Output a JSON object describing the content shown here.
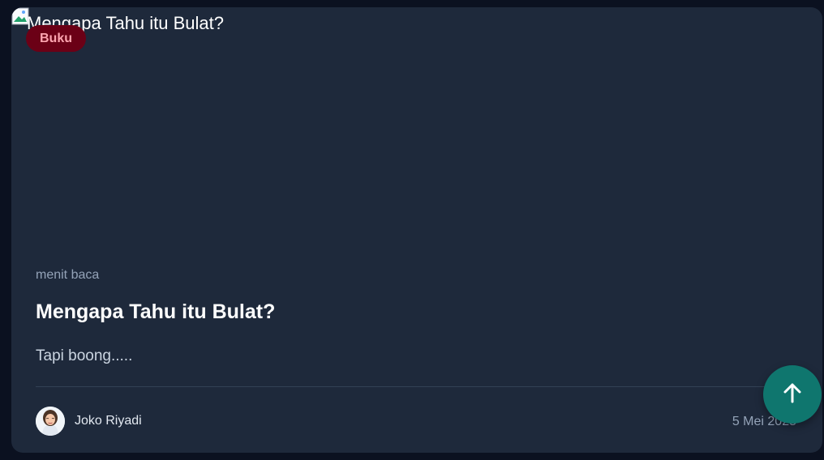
{
  "post": {
    "image_alt": "Mengapa Tahu itu Bulat?",
    "category": "Buku",
    "read_time": "menit baca",
    "title": "Mengapa Tahu itu Bulat?",
    "excerpt": "Tapi boong.....",
    "author_name": "Joko Riyadi",
    "date": "5 Mei 2025"
  },
  "icons": {
    "broken_image": "broken-image-icon",
    "avatar": "author-avatar",
    "scroll_top": "arrow-up-icon"
  },
  "colors": {
    "page_bg": "#0b1120",
    "card_bg": "#1e293b",
    "badge_bg": "#6b0016",
    "badge_text": "#fda4af",
    "accent_button": "#0f766e"
  }
}
